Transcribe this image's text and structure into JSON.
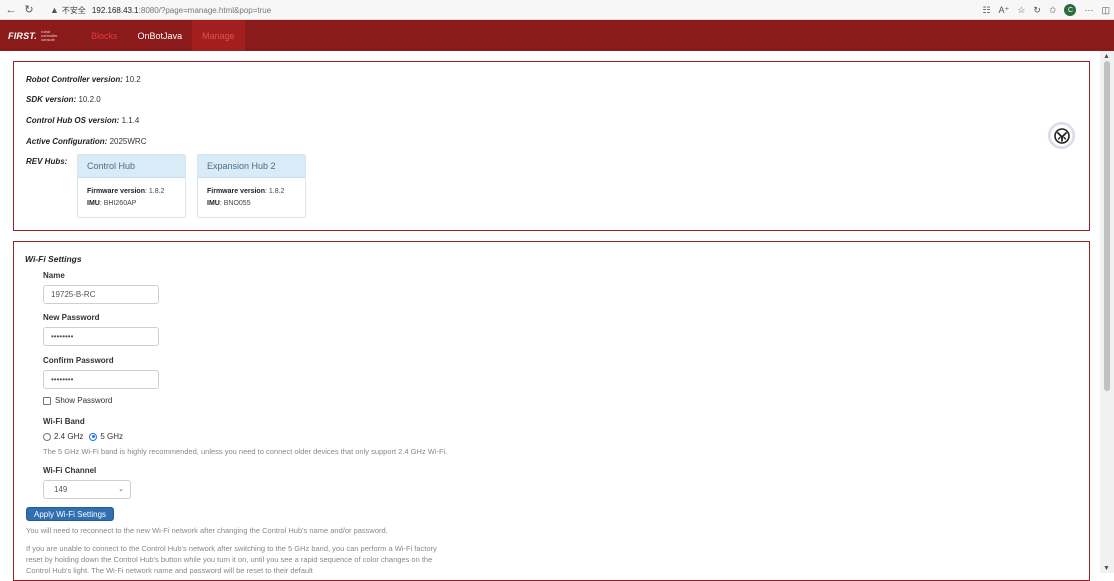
{
  "browser": {
    "insecure_label": "不安全",
    "url_host": "192.168.43.1",
    "url_path": ":8080/?page=manage.html&pop=true",
    "profile_initial": "C"
  },
  "header": {
    "logo_text": "FIRST.",
    "logo_sub": "robot controller console",
    "tabs": [
      {
        "label": "Blocks"
      },
      {
        "label": "OnBotJava"
      },
      {
        "label": "Manage"
      }
    ]
  },
  "info": {
    "rc_version_label": "Robot Controller version:",
    "rc_version": "10.2",
    "sdk_version_label": "SDK version:",
    "sdk_version": "10.2.0",
    "os_version_label": "Control Hub OS version:",
    "os_version": "1.1.4",
    "active_config_label": "Active Configuration:",
    "active_config": "2025WRC",
    "rev_hubs_label": "REV Hubs:",
    "hubs": [
      {
        "name": "Control Hub",
        "fw_label": "Firmware version",
        "fw": ": 1.8.2",
        "imu_label": "IMU",
        "imu": ": BHI260AP"
      },
      {
        "name": "Expansion Hub 2",
        "fw_label": "Firmware version",
        "fw": ": 1.8.2",
        "imu_label": "IMU",
        "imu": ": BNO055"
      }
    ]
  },
  "wifi": {
    "title": "Wi-Fi Settings",
    "name_label": "Name",
    "name_value": "19725-B-RC",
    "new_pw_label": "New Password",
    "new_pw_value": "••••••••",
    "confirm_pw_label": "Confirm Password",
    "confirm_pw_value": "••••••••",
    "show_pw_label": "Show Password",
    "band_label": "Wi-Fi Band",
    "band_options": [
      "2.4 GHz",
      "5 GHz"
    ],
    "band_selected": "5 GHz",
    "band_note": "The 5 GHz Wi-Fi band is highly recommended, unless you need to connect older devices that only support 2.4 GHz Wi-Fi.",
    "channel_label": "Wi-Fi Channel",
    "channel_value": "149",
    "apply_label": "Apply Wi-Fi Settings",
    "reconnect_note": "You will need to reconnect to the new Wi-Fi network after changing the Control Hub's name and/or password.",
    "reset_note": "If you are unable to connect to the Control Hub's network after switching to the 5 GHz band, you can perform a Wi-Fi factory reset by holding down the Control Hub's button while you turn it on, until you see a rapid sequence of color changes on the Control Hub's light. The Wi-Fi network name and password will be reset to their default"
  }
}
